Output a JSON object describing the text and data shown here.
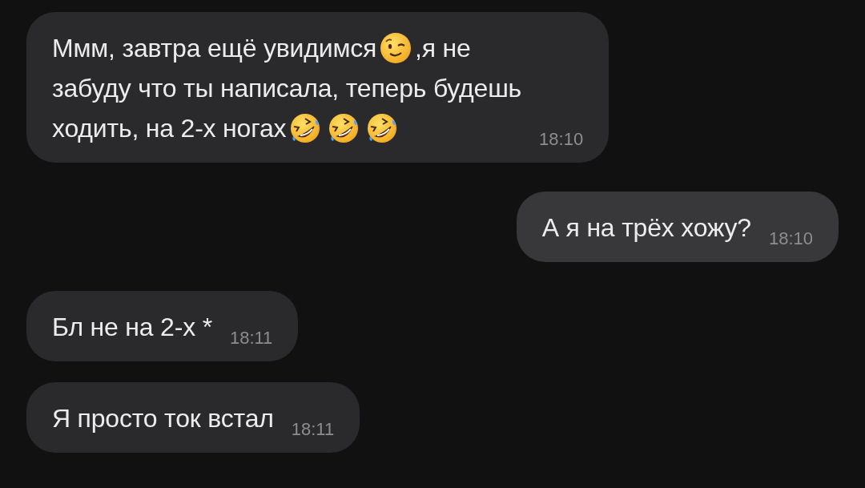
{
  "messages": [
    {
      "outgoing": false,
      "time": "18:10",
      "lines": [
        [
          {
            "kind": "text",
            "text": "Ммм, завтра ещё увидимся"
          },
          {
            "kind": "wink"
          },
          {
            "kind": "text",
            "text": ",я не"
          }
        ],
        [
          {
            "kind": "text",
            "text": "забуду что ты написала, теперь будешь"
          }
        ],
        [
          {
            "kind": "text",
            "text": "ходить, на 2-х ногах"
          },
          {
            "kind": "rofl"
          },
          {
            "kind": "rofl"
          },
          {
            "kind": "rofl"
          }
        ]
      ]
    },
    {
      "outgoing": true,
      "time": "18:10",
      "lines": [
        [
          {
            "kind": "text",
            "text": "А я на трёх хожу?"
          }
        ]
      ]
    },
    {
      "outgoing": false,
      "time": "18:11",
      "lines": [
        [
          {
            "kind": "text",
            "text": "Бл не на 2-х *"
          }
        ]
      ]
    },
    {
      "outgoing": false,
      "time": "18:11",
      "lines": [
        [
          {
            "kind": "text",
            "text": "Я просто ток встал"
          }
        ]
      ]
    }
  ]
}
